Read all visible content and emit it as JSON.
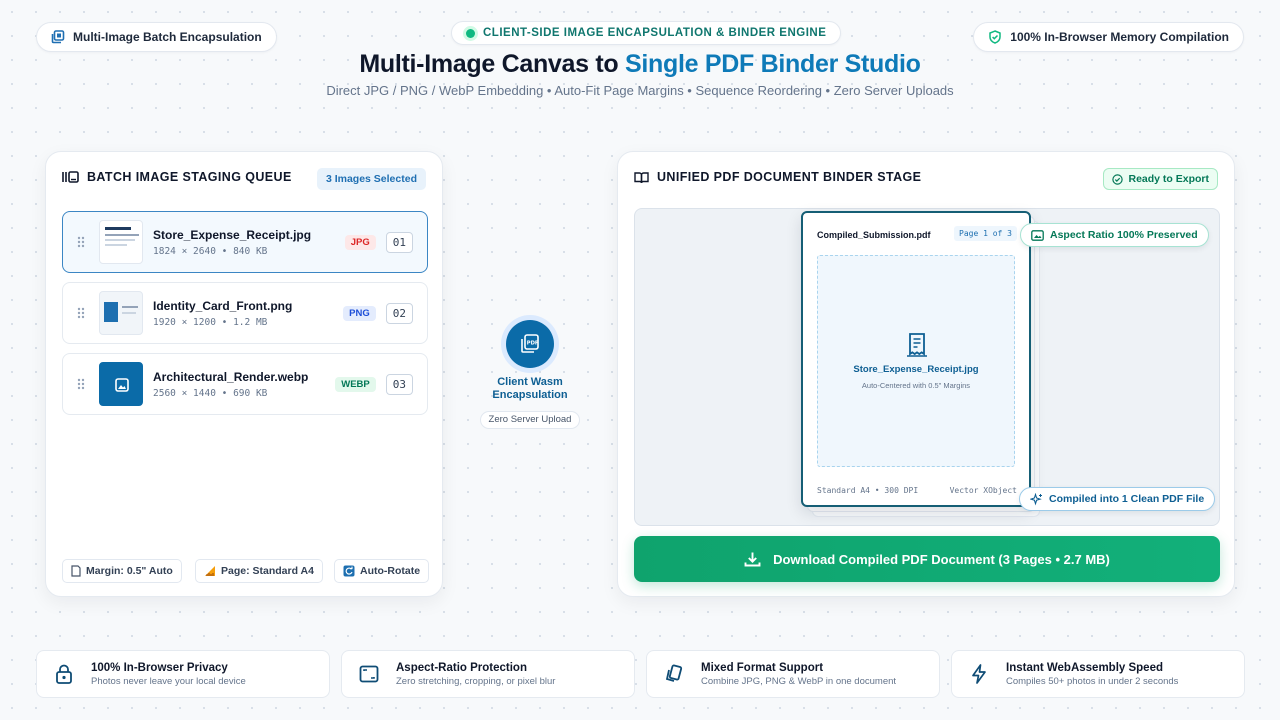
{
  "header": {
    "left_pill": "Multi-Image Batch Encapsulation",
    "engine_pill": "CLIENT-SIDE IMAGE ENCAPSULATION & BINDER ENGINE",
    "right_pill": "100% In-Browser Memory Compilation",
    "title_plain": "Multi-Image Canvas to ",
    "title_accent": "Single PDF Binder Studio",
    "subtitle": "Direct JPG / PNG / WebP Embedding • Auto-Fit Page Margins • Sequence Reordering • Zero Server Uploads"
  },
  "queue": {
    "title": "BATCH IMAGE STAGING QUEUE",
    "selected_badge": "3 Images Selected",
    "items": [
      {
        "name": "Store_Expense_Receipt.jpg",
        "meta": "1824 × 2640 • 840 KB",
        "format": "JPG",
        "index": "01"
      },
      {
        "name": "Identity_Card_Front.png",
        "meta": "1920 × 1200 • 1.2 MB",
        "format": "PNG",
        "index": "02"
      },
      {
        "name": "Architectural_Render.webp",
        "meta": "2560 × 1440 • 690 KB",
        "format": "WEBP",
        "index": "03"
      }
    ],
    "options": {
      "margin": "Margin: 0.5\" Auto",
      "page": "Page: Standard A4",
      "rotate": "Auto-Rotate"
    }
  },
  "wasm": {
    "label": "Client Wasm Encapsulation",
    "tag": "Zero Server Upload"
  },
  "binder": {
    "title": "UNIFIED PDF DOCUMENT BINDER STAGE",
    "status": "Ready to Export",
    "sheet_name": "Compiled_Submission.pdf",
    "page_indicator": "Page 1 of 3",
    "inner_file": "Store_Expense_Receipt.jpg",
    "inner_sub": "Auto-Centered with 0.5\" Margins",
    "foot_left": "Standard A4 • 300 DPI",
    "foot_right": "Vector XObject",
    "chip_aspect": "Aspect Ratio 100% Preserved",
    "chip_compiled": "Compiled into 1 Clean PDF File",
    "download": "Download Compiled PDF Document (3 Pages • 2.7 MB)"
  },
  "features": [
    {
      "title": "100% In-Browser Privacy",
      "sub": "Photos never leave your local device"
    },
    {
      "title": "Aspect-Ratio Protection",
      "sub": "Zero stretching, cropping, or pixel blur"
    },
    {
      "title": "Mixed Format Support",
      "sub": "Combine JPG, PNG & WebP in one document"
    },
    {
      "title": "Instant WebAssembly Speed",
      "sub": "Compiles 50+ photos in under 2 seconds"
    }
  ],
  "colors": {
    "accent": "#0e7ab8",
    "success": "#12b07a",
    "jpg_tag": "#dc2626",
    "png_tag": "#1d4ed8",
    "webp_tag": "#047857"
  }
}
